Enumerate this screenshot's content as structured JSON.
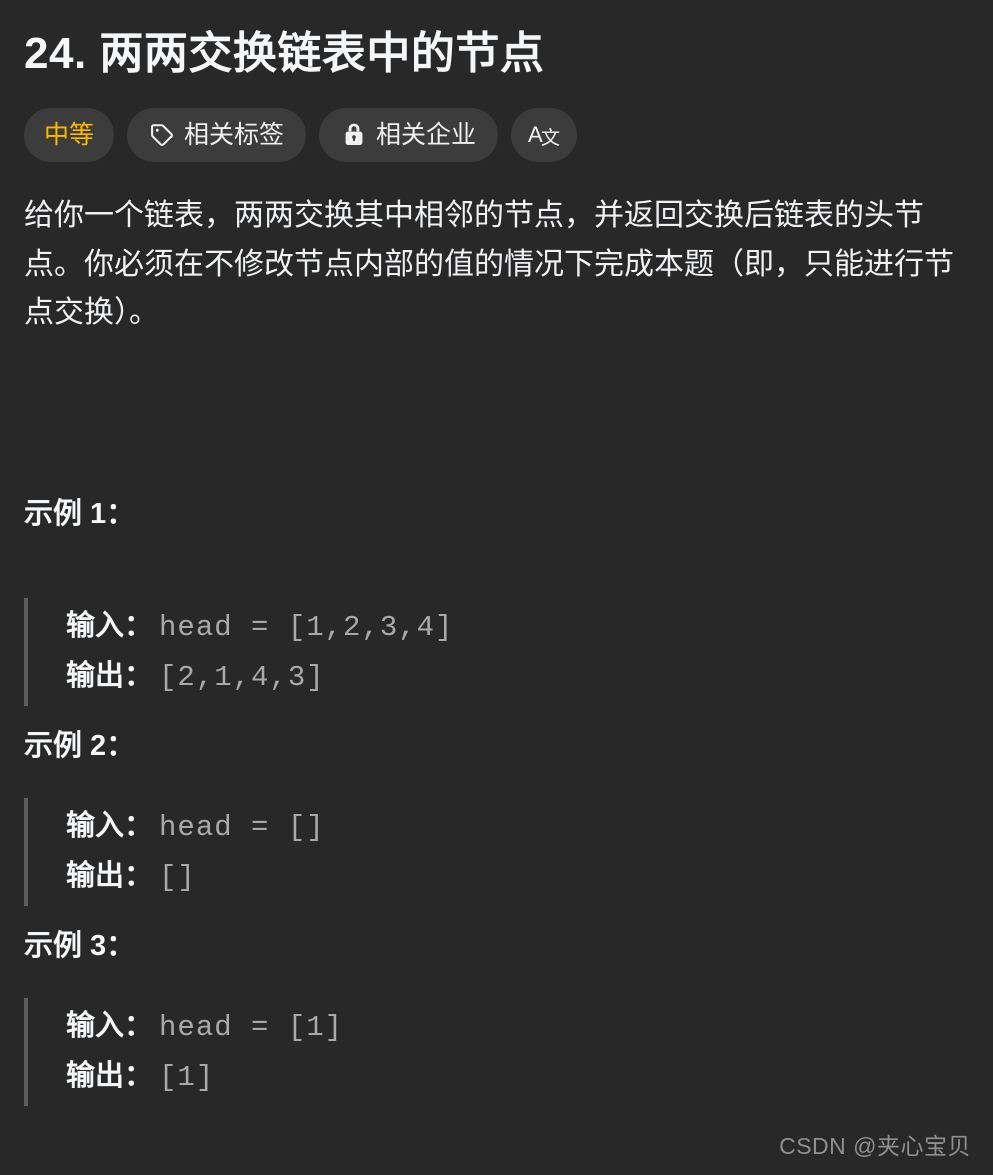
{
  "page": {
    "background_color": "#282828",
    "text_color": "#f0f1f3"
  },
  "title": "24. 两两交换链表中的节点",
  "badges": [
    {
      "label": "中等",
      "icon": "",
      "icon_name": "difficulty-text",
      "accent_color": "#ffb800",
      "kind": "difficulty"
    },
    {
      "label": "相关标签",
      "icon": "tag",
      "icon_name": "tag-icon",
      "accent_color": "#f0f0f0",
      "kind": "normal"
    },
    {
      "label": "相关企业",
      "icon": "lock",
      "icon_name": "lock-icon",
      "accent_color": "#f0f0f0",
      "kind": "normal"
    },
    {
      "label": "",
      "icon": "translate",
      "icon_name": "translate-icon",
      "accent_color": "#f0f0f0",
      "kind": "icon-only"
    }
  ],
  "description": "给你一个链表，两两交换其中相邻的节点，并返回交换后链表的头节点。你必须在不修改节点内部的值的情况下完成本题（即，只能进行节点交换）。",
  "examples": [
    {
      "heading": "示例 1：",
      "input_label": "输入：",
      "input_value": "head = [1,2,3,4]",
      "output_label": "输出：",
      "output_value": "[2,1,4,3]"
    },
    {
      "heading": "示例 2：",
      "input_label": "输入：",
      "input_value": "head = []",
      "output_label": "输出：",
      "output_value": "[]"
    },
    {
      "heading": "示例 3：",
      "input_label": "输入：",
      "input_value": "head = [1]",
      "output_label": "输出：",
      "output_value": "[1]"
    }
  ],
  "watermark": "CSDN @夹心宝贝"
}
